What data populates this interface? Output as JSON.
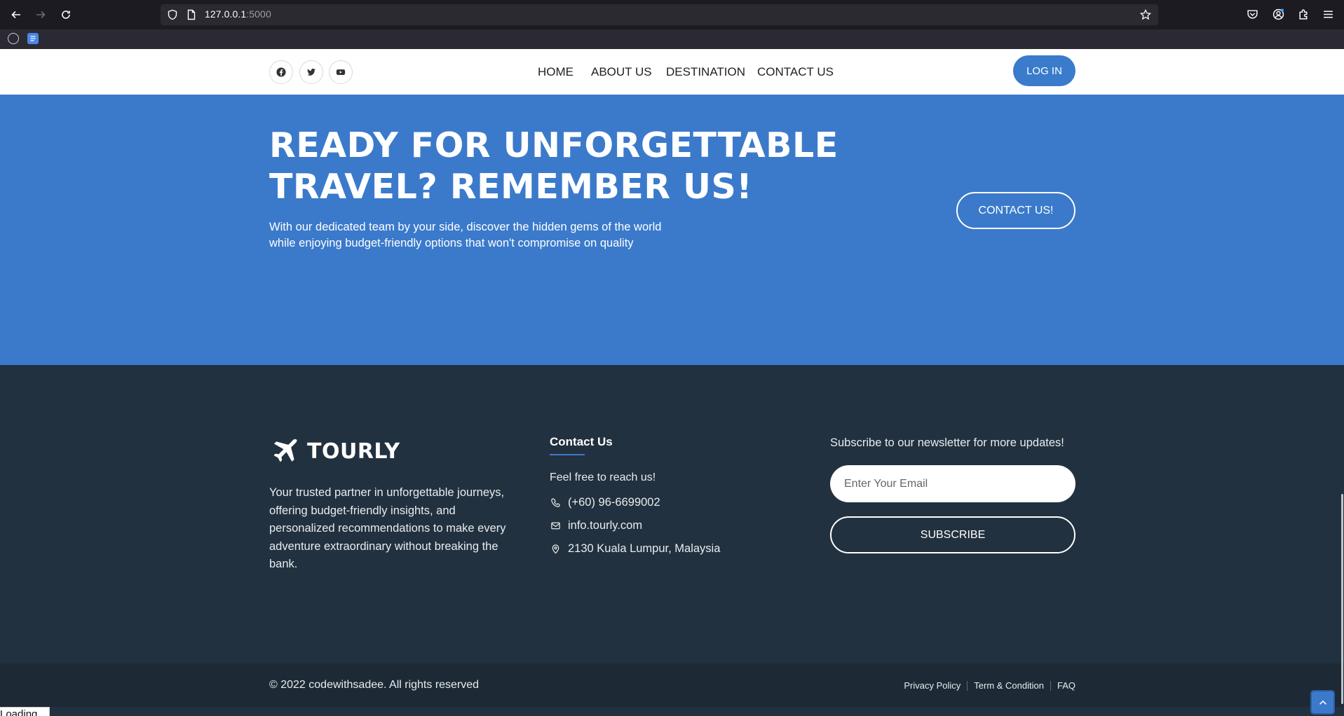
{
  "browser": {
    "url_host": "127.0.0.1",
    "url_port": ":5000"
  },
  "header": {
    "nav": [
      "HOME",
      "ABOUT US",
      "DESTINATION",
      "CONTACT US"
    ],
    "login_label": "LOG IN"
  },
  "hero": {
    "title_line1": "READY FOR UNFORGETTABLE",
    "title_line2": "TRAVEL? REMEMBER US!",
    "subtitle": "With our dedicated team by your side, discover the hidden gems of the world while enjoying budget-friendly options that won't compromise on quality",
    "button_label": "CONTACT US!"
  },
  "footer": {
    "brand": "TOURLY",
    "about": "Your trusted partner in unforgettable journeys, offering budget-friendly insights, and personalized recommendations to make every adventure extraordinary without breaking the bank.",
    "contact_title": "Contact Us",
    "contact_intro": "Feel free to reach us!",
    "phone": "(+60) 96-6699002",
    "email": "info.tourly.com",
    "address": "2130 Kuala Lumpur, Malaysia",
    "newsletter_title": "Subscribe to our newsletter for more updates!",
    "email_placeholder": "Enter Your Email",
    "subscribe_label": "SUBSCRIBE"
  },
  "bottom": {
    "copyright": "© 2022 codewithsadee. All rights reserved",
    "links": [
      "Privacy Policy",
      "Term & Condition",
      "FAQ"
    ]
  },
  "status": {
    "text": "Loading..."
  },
  "colors": {
    "accent": "#3b7acb",
    "footer_bg": "#22313f",
    "bottom_bg": "#1d2a36"
  }
}
